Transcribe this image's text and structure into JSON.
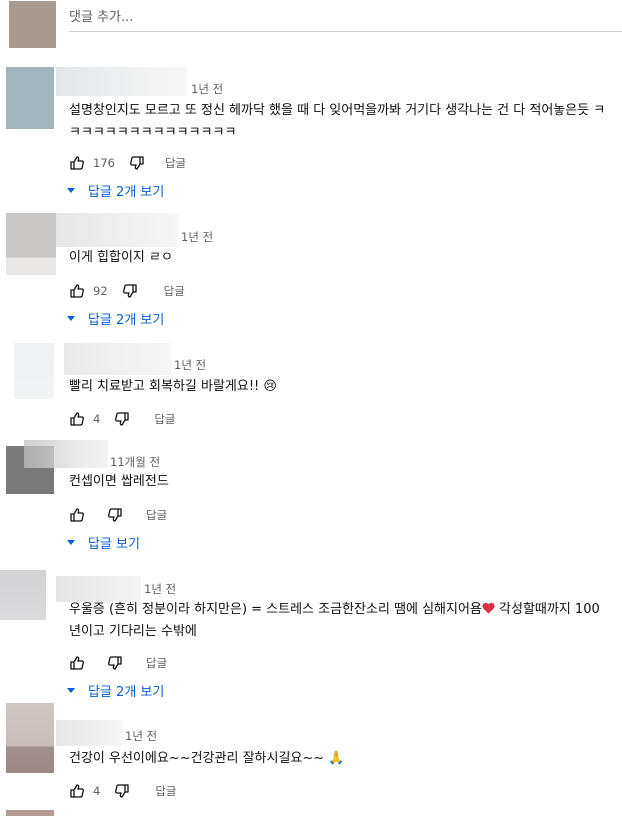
{
  "add_comment": {
    "placeholder": "댓글 추가..."
  },
  "colors": {
    "link": "#065fd4",
    "meta": "#606060",
    "text": "#0f0f0f"
  },
  "comments": [
    {
      "time": "1년 전",
      "text": "설명창인지도 모르고 또 정신 헤까닥 했을 때 다 잊어먹을까봐 거기다 생각나는 건 다 적어놓은듯 ㅋㅋㅋㅋㅋㅋㅋㅋㅋㅋㅋㅋㅋㅋㅋ",
      "likes": "176",
      "reply_label": "답글",
      "replies_label": "답글 2개 보기"
    },
    {
      "time": "1년 전",
      "text": "이게 힙합이지 ㄹㅇ",
      "likes": "92",
      "reply_label": "답글",
      "replies_label": "답글 2개 보기"
    },
    {
      "time": "1년 전",
      "text": "빨리 치료받고 회복하길 바랄게요!! 😢",
      "likes": "4",
      "reply_label": "답글"
    },
    {
      "time": "11개월 전",
      "text": "컨셉이면 쌉레전드",
      "likes": "",
      "reply_label": "답글",
      "replies_label": "답글 보기"
    },
    {
      "time": "1년 전",
      "text_before": "우울증 (흔히 정분이라 하지만은) = 스트레스 조금한잔소리 땜에 심해지어욤",
      "text_after": " 각성할때까지 100년이고 기다리는 수밖에",
      "likes": "",
      "reply_label": "답글",
      "replies_label": "답글 2개 보기"
    },
    {
      "time": "1년 전",
      "text": "건강이 우선이에요~~건강관리 잘하시길요~~ 🙏",
      "likes": "4",
      "reply_label": "답글"
    }
  ]
}
